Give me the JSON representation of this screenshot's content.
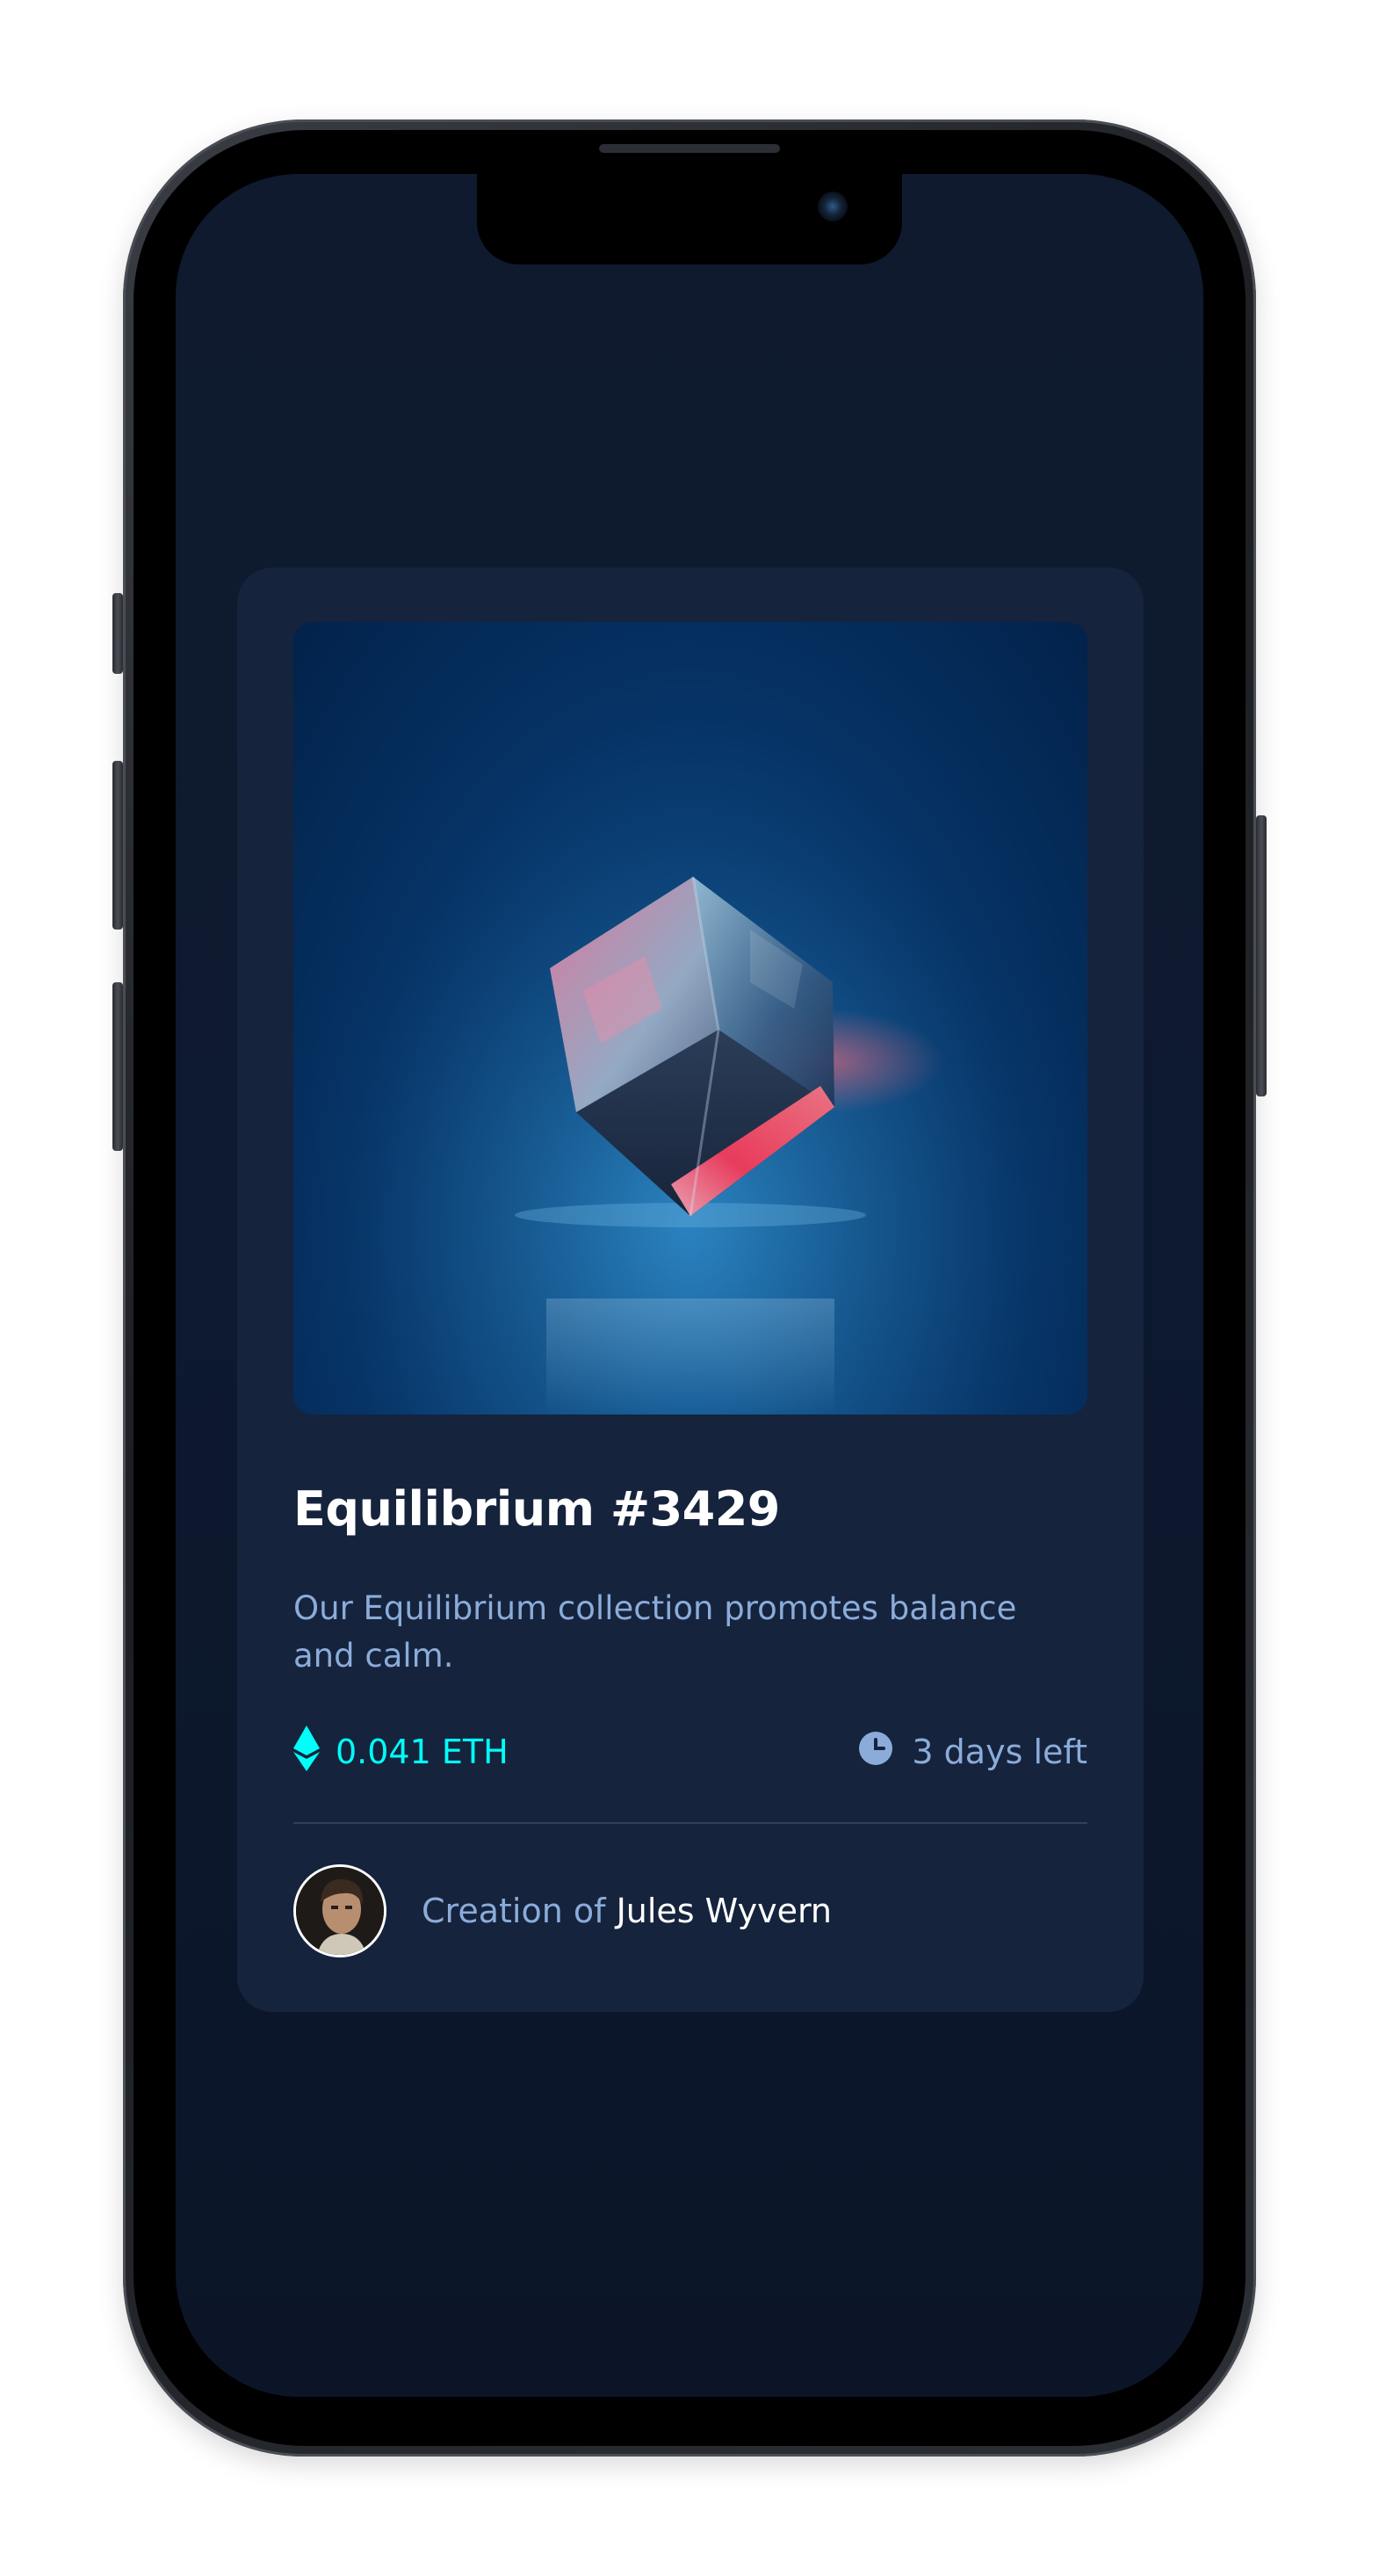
{
  "nft": {
    "title": "Equilibrium #3429",
    "description": "Our Equilibrium collection promotes balance and calm.",
    "price": "0.041 ETH",
    "time_left": "3 days left",
    "creator_prefix": "Creation of",
    "creator_name": "Jules Wyvern"
  },
  "icons": {
    "price": "ethereum-icon",
    "time": "clock-icon",
    "avatar": "creator-avatar"
  },
  "colors": {
    "page_bg": "#0D1A2F",
    "card_bg": "#15233D",
    "accent_cyan": "#00FFF8",
    "soft_blue": "#8BACD9",
    "white": "#FFFFFF",
    "divider": "#2E405A"
  }
}
